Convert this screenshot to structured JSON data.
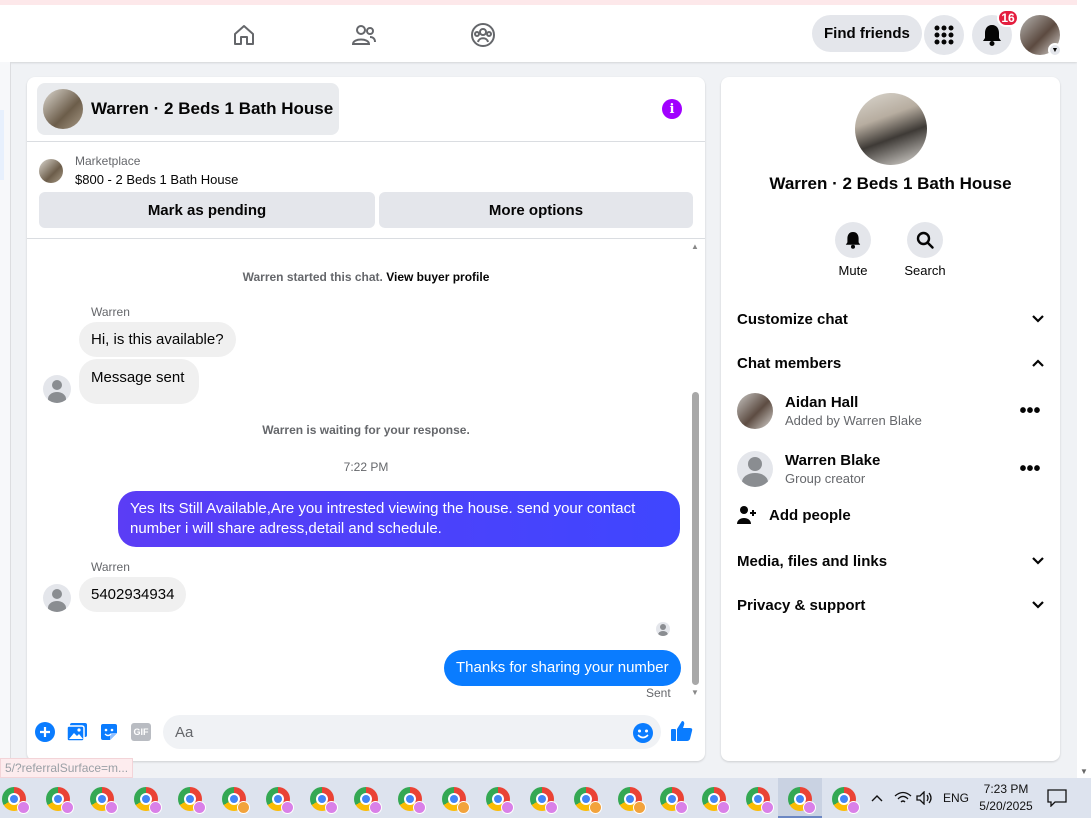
{
  "nav": {
    "find_friends": "Find friends",
    "notification_count": "16"
  },
  "chat": {
    "title": "Warren · 2 Beds 1 Bath House",
    "marketplace_label": "Marketplace",
    "listing": "$800 - 2 Beds 1 Bath House",
    "mark_pending": "Mark as pending",
    "more_options": "More options",
    "started_text": "Warren started this chat.",
    "view_profile": "View buyer profile",
    "waiting_text": "Warren is waiting for your response.",
    "timestamp": "7:22 PM",
    "messages": [
      {
        "sender": "Warren",
        "text": "Hi, is this available?"
      },
      {
        "text": "Message sent"
      },
      {
        "text": "Yes Its Still Available,Are you intrested viewing the house. send your contact number i will share adress,detail and schedule."
      },
      {
        "sender": "Warren",
        "text": "5402934934"
      },
      {
        "text": "Thanks for sharing your number"
      }
    ],
    "sent_label": "Sent",
    "input_placeholder": "Aa",
    "gif_label": "GIF"
  },
  "info": {
    "title": "Warren · 2 Beds 1 Bath House",
    "mute": "Mute",
    "search": "Search",
    "customize": "Customize chat",
    "members_header": "Chat members",
    "members": [
      {
        "name": "Aidan Hall",
        "sub": "Added by Warren Blake"
      },
      {
        "name": "Warren Blake",
        "sub": "Group creator"
      }
    ],
    "add_people": "Add people",
    "media": "Media, files and links",
    "privacy": "Privacy & support"
  },
  "status_url": "5/?referralSurface=m...",
  "taskbar": {
    "lang": "ENG",
    "time": "7:23 PM",
    "date": "5/20/2025"
  },
  "colors": {
    "brand_blue": "#0a7cff",
    "info_purple": "#a100ff",
    "badge_red": "#e41e3f"
  }
}
